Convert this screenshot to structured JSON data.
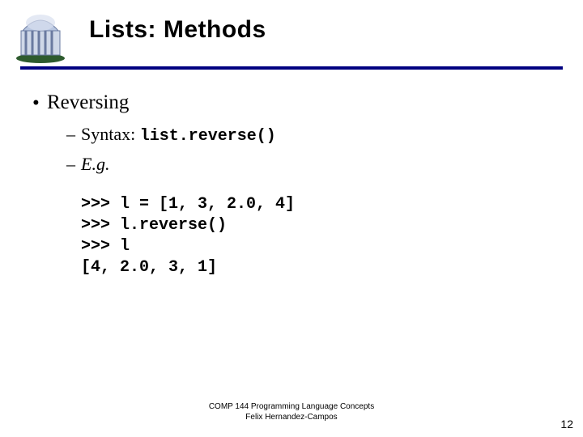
{
  "header": {
    "title": "Lists: Methods",
    "icon": "well-dome-logo"
  },
  "body": {
    "bullet1": "Reversing",
    "syntax_label": "Syntax:",
    "syntax_code": "list.reverse()",
    "eg_label": "E.g.",
    "code_lines": [
      ">>> l = [1, 3, 2.0, 4]",
      ">>> l.reverse()",
      ">>> l",
      "[4, 2.0, 3, 1]"
    ]
  },
  "footer": {
    "line1": "COMP 144 Programming Language Concepts",
    "line2": "Felix Hernandez-Campos"
  },
  "page_number": "12"
}
